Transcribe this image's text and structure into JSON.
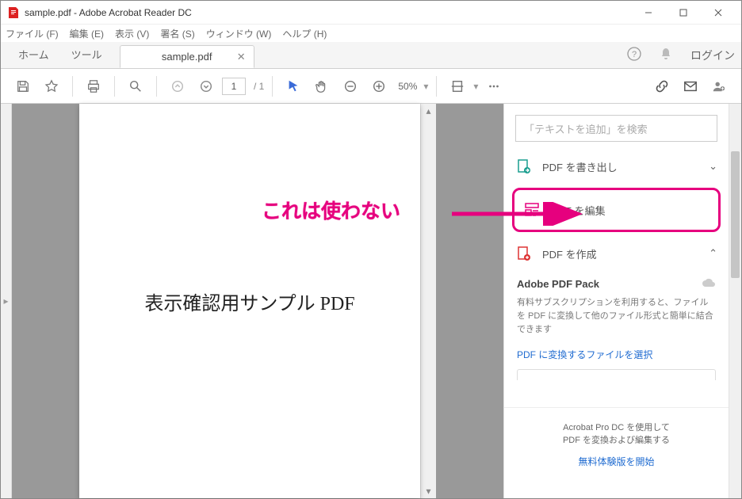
{
  "window": {
    "title": "sample.pdf - Adobe Acrobat Reader DC"
  },
  "menu": {
    "items": [
      "ファイル (F)",
      "編集 (E)",
      "表示 (V)",
      "署名 (S)",
      "ウィンドウ (W)",
      "ヘルプ (H)"
    ]
  },
  "tabs": {
    "home": "ホーム",
    "tools": "ツール",
    "doc": "sample.pdf",
    "login": "ログイン"
  },
  "toolbar": {
    "page_current": "1",
    "page_total": "/ 1",
    "zoom": "50%"
  },
  "page": {
    "body": "表示確認用サンプル PDF"
  },
  "rpanel": {
    "search_placeholder": "「テキストを追加」を検索",
    "export": "PDF を書き出し",
    "edit": "PDF を編集",
    "create": "PDF を作成",
    "pack_title": "Adobe PDF Pack",
    "pack_desc": "有料サブスクリプションを利用すると、ファイルを PDF に変換して他のファイル形式と簡単に結合できます",
    "select_file": "PDF に変換するファイルを選択",
    "trial_p1": "Acrobat Pro DC を使用して",
    "trial_p2": "PDF を変換および編集する",
    "trial_link": "無料体験版を開始"
  },
  "annotation": {
    "text": "これは使わない"
  }
}
